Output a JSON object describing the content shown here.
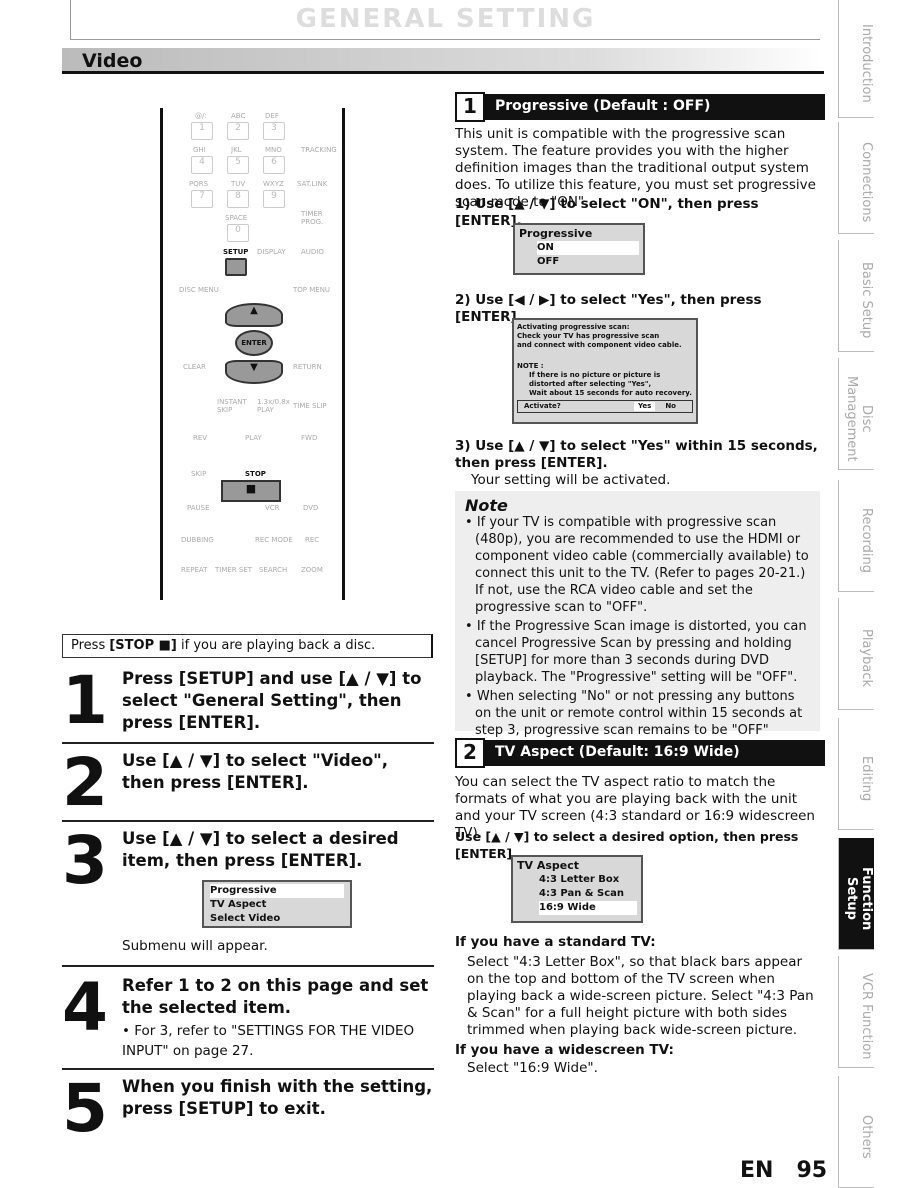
{
  "header": {
    "title": "GENERAL SETTING",
    "section": "Video"
  },
  "remote": {
    "rows": [
      [
        "1",
        "2",
        "3"
      ],
      [
        "4",
        "5",
        "6"
      ],
      [
        "7",
        "8",
        "9"
      ]
    ],
    "labels": [
      "@/:",
      "ABC",
      "DEF",
      "GHI",
      "JKL",
      "MNO",
      "PQRS",
      "TUV",
      "WXYZ"
    ],
    "tracking": "TRACKING",
    "satlink": "SAT.LINK",
    "space": "SPACE",
    "zero": "0",
    "timer_prog": "TIMER PROG.",
    "setup": "SETUP",
    "display": "DISPLAY",
    "audio": "AUDIO",
    "disc_menu": "DISC MENU",
    "top_menu": "TOP MENU",
    "enter": "ENTER",
    "clear": "CLEAR",
    "return": "RETURN",
    "instant_skip": "INSTANT SKIP",
    "play_speed": "1.3x/0.8x PLAY",
    "time_slip": "TIME SLIP",
    "rev": "REV",
    "play": "PLAY",
    "fwd": "FWD",
    "skip": "SKIP",
    "stop": "STOP",
    "pause": "PAUSE",
    "vcr": "VCR",
    "dvd": "DVD",
    "dubbing": "DUBBING",
    "rec_mode": "REC MODE",
    "rec": "REC",
    "repeat": "REPEAT",
    "timer_set": "TIMER SET",
    "search": "SEARCH",
    "zoom": "ZOOM"
  },
  "stop_note": {
    "pre": "Press ",
    "key": "[STOP ■]",
    "post": " if you are playing back a disc."
  },
  "steps": [
    {
      "num": "1",
      "title": "Press [SETUP] and use [▲ / ▼] to select \"General Setting\", then press [ENTER]."
    },
    {
      "num": "2",
      "title": "Use [▲ / ▼] to select \"Video\", then press [ENTER]."
    },
    {
      "num": "3",
      "title": "Use [▲ / ▼] to select a desired item, then press [ENTER].",
      "menu": [
        "Progressive",
        "TV Aspect",
        "Select Video"
      ],
      "after": "Submenu will appear."
    },
    {
      "num": "4",
      "title": "Refer 1 to 2 on this page and set the selected item.",
      "bullet": "• For 3, refer to \"SETTINGS FOR THE VIDEO INPUT\" on page 27."
    },
    {
      "num": "5",
      "title": "When you finish with the setting, press [SETUP] to exit."
    }
  ],
  "progressive": {
    "num": "1",
    "heading": "Progressive (Default : OFF)",
    "intro": "This unit is compatible with the progressive scan system. The feature provides you with the higher definition images than the traditional output system does. To utilize this feature, you must set progressive scan mode to \"ON\".",
    "s1": "1) Use [▲ / ▼] to select \"ON\", then press [ENTER].",
    "osd1": {
      "title": "Progressive",
      "options": [
        "ON",
        "OFF"
      ],
      "checked": "OFF"
    },
    "s2": "2) Use [◀ / ▶] to select \"Yes\", then press [ENTER].",
    "osd2": {
      "lines": [
        "Activating progressive scan:",
        "Check your TV has progressive scan",
        "and connect with component video cable."
      ],
      "note": "NOTE :",
      "note_lines": [
        "If there is no picture or picture is",
        "distorted after selecting \"Yes\",",
        "Wait about 15 seconds for auto recovery."
      ],
      "prompt": "Activate?",
      "yes": "Yes",
      "no": "No"
    },
    "s3": "3) Use [▲ / ▼] to select \"Yes\" within 15 seconds, then press [ENTER].",
    "s3b": "Your setting will be activated."
  },
  "note": {
    "title": "Note",
    "items": [
      "If your TV is compatible with progressive scan (480p), you are recommended to use the HDMI or component video cable (commercially available) to connect this unit to the TV. (Refer to pages 20-21.) If not, use the RCA video cable and set the progressive scan to \"OFF\".",
      "If the Progressive Scan image is distorted, you can cancel Progressive Scan by pressing and holding [SETUP] for more than 3 seconds during DVD playback. The \"Progressive\" setting will be \"OFF\".",
      "When selecting \"No\" or not pressing any buttons on the unit or remote control within 15 seconds at step 3, progressive scan remains to be \"OFF\" (interlace scan)."
    ]
  },
  "aspect": {
    "num": "2",
    "heading": "TV Aspect (Default: 16:9 Wide)",
    "intro": "You can select the TV aspect ratio to match the formats of what you are playing back with the unit and your TV screen (4:3 standard or 16:9 widescreen TV).",
    "s1": "Use [▲ / ▼] to select a desired option, then press [ENTER].",
    "osd": {
      "title": "TV Aspect",
      "options": [
        "4:3 Letter Box",
        "4:3 Pan & Scan",
        "16:9 Wide"
      ],
      "checked": "16:9 Wide"
    },
    "std_h": "If you have a standard TV:",
    "std": "Select \"4:3 Letter Box\", so that black bars appear on the top and bottom of the TV screen when playing back a wide-screen picture. Select \"4:3 Pan & Scan\" for a full height picture with both sides trimmed when playing back wide-screen picture.",
    "wide_h": "If you have a widescreen TV:",
    "wide": "Select \"16:9 Wide\"."
  },
  "tabs": [
    "Introduction",
    "Connections",
    "Basic Setup",
    "Disc Management",
    "Recording",
    "Playback",
    "Editing",
    "Function Setup",
    "VCR Function",
    "Others"
  ],
  "active_tab": "Function Setup",
  "footer": {
    "lang": "EN",
    "page": "95"
  }
}
